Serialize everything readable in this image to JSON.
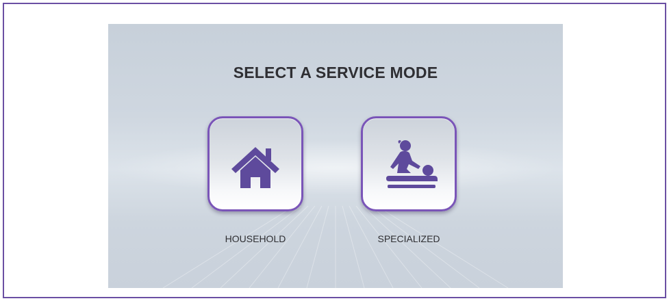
{
  "screen": {
    "title": "SELECT A SERVICE MODE"
  },
  "modes": [
    {
      "label": "HOUSEHOLD",
      "icon": "house-icon"
    },
    {
      "label": "SPECIALIZED",
      "icon": "massage-icon"
    }
  ],
  "colors": {
    "frame_border": "#6a4fa3",
    "button_border": "#7a55b8",
    "icon_fill": "#5e4a9c",
    "title_text": "#2f2f33"
  }
}
